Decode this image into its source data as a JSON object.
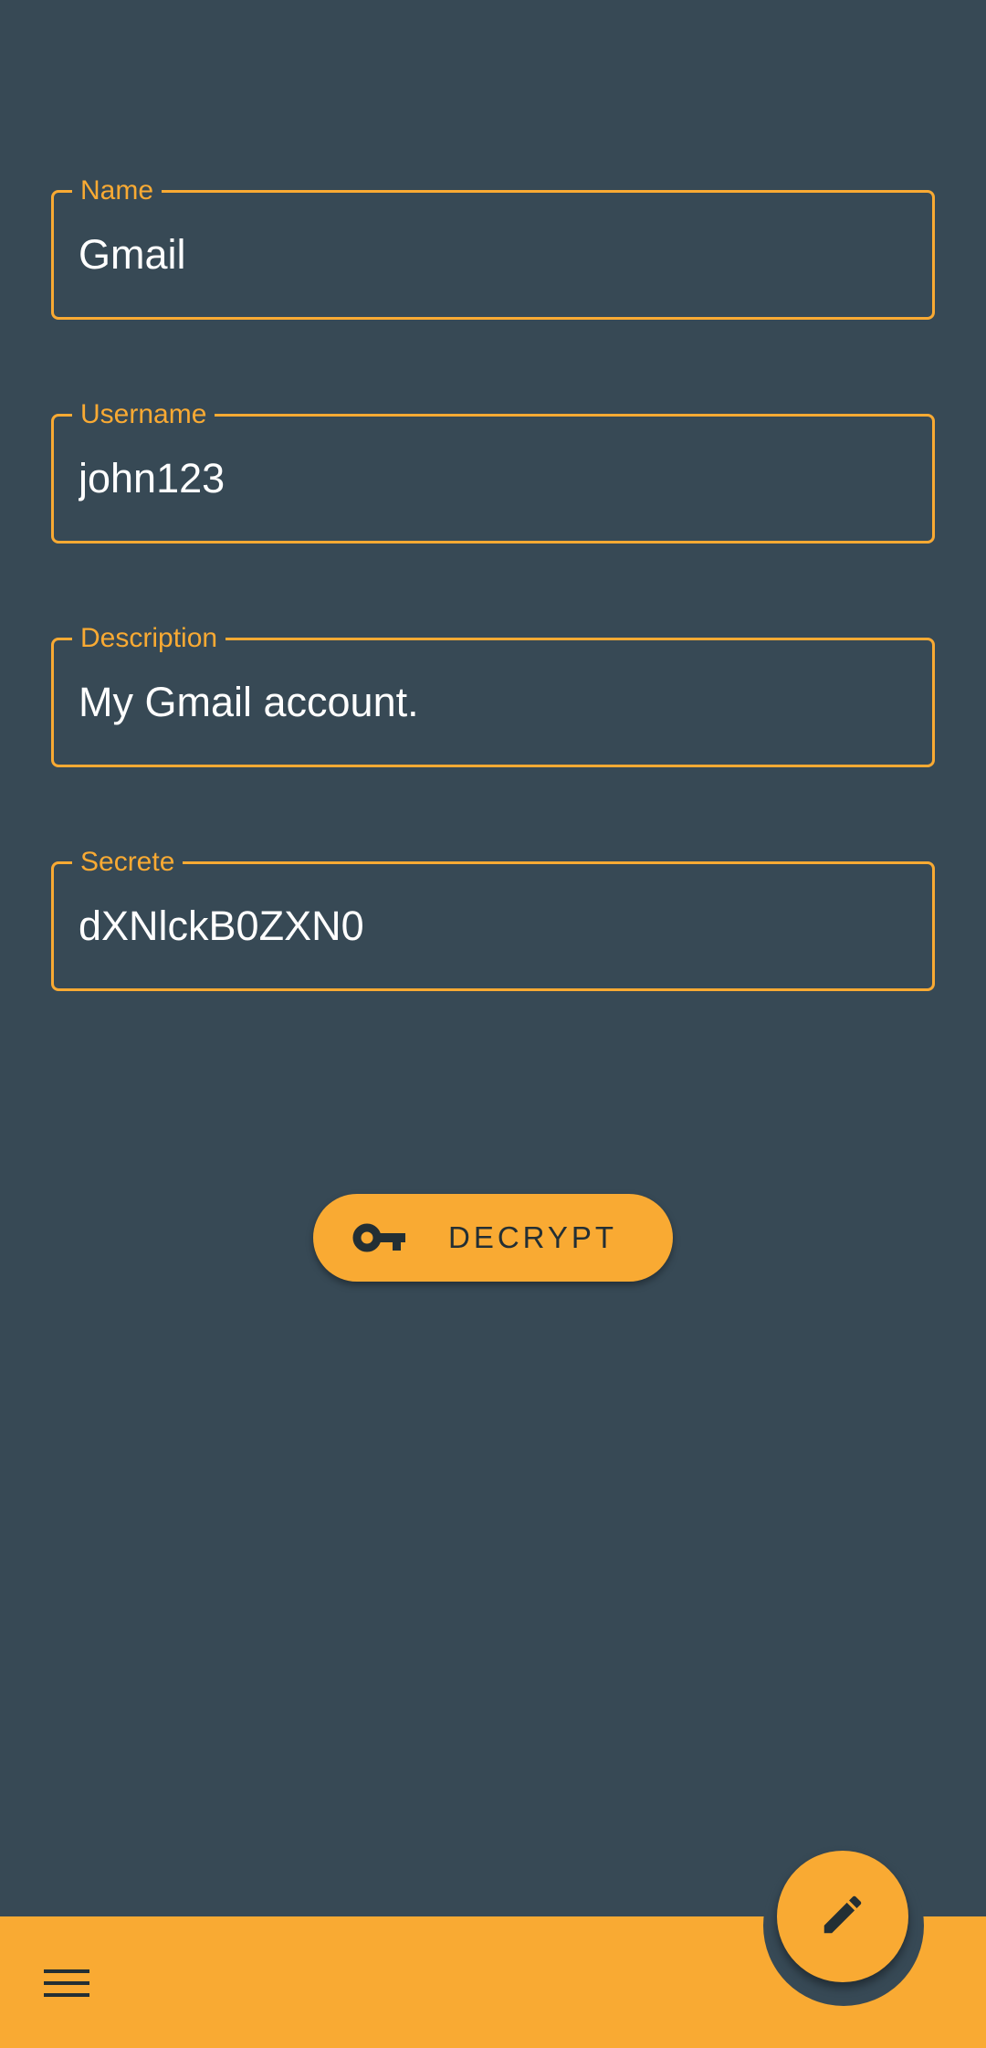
{
  "form": {
    "name": {
      "label": "Name",
      "value": "Gmail"
    },
    "username": {
      "label": "Username",
      "value": "john123"
    },
    "description": {
      "label": "Description",
      "value": "My Gmail account."
    },
    "secrete": {
      "label": "Secrete",
      "value": "dXNlckB0ZXN0"
    }
  },
  "decrypt_button": {
    "label": "DECRYPT",
    "icon": "key-icon"
  },
  "bottom_bar": {
    "menu_icon": "menu-icon"
  },
  "fab": {
    "icon": "edit-icon"
  },
  "colors": {
    "background": "#374955",
    "accent": "#F9AA33",
    "text_on_accent": "#232F34",
    "text": "#FFFFFF"
  }
}
